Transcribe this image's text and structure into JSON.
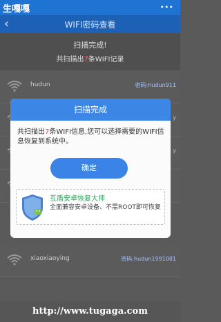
{
  "statusbar": {
    "left_text": "生嘎嘎",
    "right_icon": "more-dots-icon"
  },
  "appbar": {
    "back_icon": "back-arrow-icon",
    "title": "WIFI密码查看"
  },
  "summary": {
    "line1": "扫描完成!",
    "line2_prefix": "共扫描出",
    "line2_count": "7",
    "line2_suffix": "条WIFI记录"
  },
  "rows": [
    {
      "ssid": "hudun",
      "password": "密码:hudun911"
    },
    {
      "ssid": "",
      "password": "y"
    },
    {
      "ssid": "",
      "password": "y"
    },
    {
      "ssid": "",
      "password": ""
    },
    {
      "ssid": "xiaoxiaoying",
      "password": "密码:hudun1991081"
    }
  ],
  "dialog": {
    "title": "扫描完成",
    "msg_prefix": "共扫描出",
    "msg_count": "7",
    "msg_suffix": "条WIFI信息,您可以选择需要的WIFI信息恢复到系统中。",
    "confirm_label": "确定",
    "promo": {
      "icon": "shield-android-icon",
      "title": "互盾安卓恢复大师",
      "desc": "全面兼容安卓设备、不需ROOT即可恢复"
    }
  },
  "footer": {
    "url": "http://www.tugaga.com"
  },
  "colors": {
    "primary": "#3b83e6",
    "status": "#1f73d2",
    "accent_red": "#ff3b3b",
    "promo_green": "#2aa55a"
  }
}
